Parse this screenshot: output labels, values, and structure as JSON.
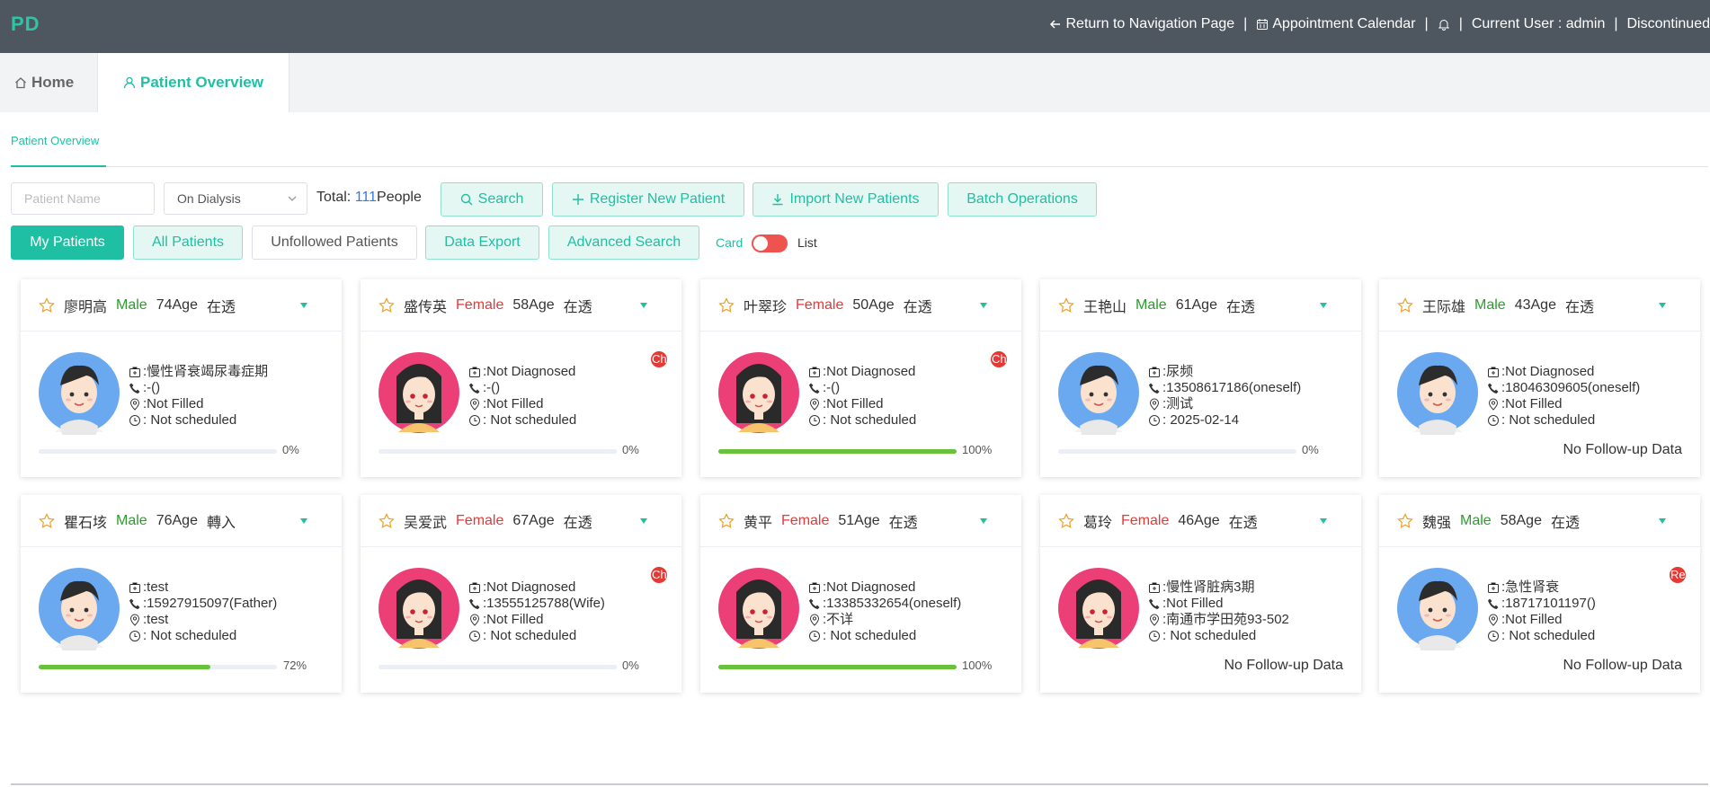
{
  "app": {
    "logo": "PD"
  },
  "topnav": {
    "return_label": "Return to Navigation Page",
    "calendar_label": "Appointment Calendar",
    "current_user": "Current User : admin",
    "discontinued": "Discontinued"
  },
  "tabs": {
    "home": "Home",
    "patient_overview": "Patient Overview"
  },
  "page": {
    "subtitle": "Patient Overview"
  },
  "filters": {
    "name_placeholder": "Patient Name",
    "status_value": "On Dialysis",
    "total_label": "Total:",
    "total_count": "111",
    "total_unit": "People"
  },
  "toolbar": {
    "search": "Search",
    "register": "Register New Patient",
    "import": "Import New Patients",
    "batch": "Batch Operations",
    "my_patients": "My Patients",
    "all_patients": "All Patients",
    "unfollowed": "Unfollowed Patients",
    "export": "Data Export",
    "advanced": "Advanced Search",
    "view_card": "Card",
    "view_list": "List"
  },
  "colors": {
    "accent": "#1fbfa4",
    "topbar": "#4e5660",
    "male": "#2a9d2a",
    "female": "#e53935",
    "progress": "#67c23a"
  },
  "patients": [
    {
      "name": "廖明高",
      "gender": "Male",
      "age": "74Age",
      "status": "在透",
      "diagnosis": ":慢性肾衰竭尿毒症期",
      "phone": ":-()",
      "address": ":Not Filled",
      "schedule": ": Not scheduled",
      "progress": 0,
      "progress_label": "0%",
      "followup": "",
      "badge": ""
    },
    {
      "name": "盛传英",
      "gender": "Female",
      "age": "58Age",
      "status": "在透",
      "diagnosis": ":Not Diagnosed",
      "phone": ":-()",
      "address": ":Not Filled",
      "schedule": ": Not scheduled",
      "progress": 0,
      "progress_label": "0%",
      "followup": "",
      "badge": "Ch"
    },
    {
      "name": "叶翠珍",
      "gender": "Female",
      "age": "50Age",
      "status": "在透",
      "diagnosis": ":Not Diagnosed",
      "phone": ":-()",
      "address": ":Not Filled",
      "schedule": ": Not scheduled",
      "progress": 100,
      "progress_label": "100%",
      "followup": "",
      "badge": "Ch"
    },
    {
      "name": "王艳山",
      "gender": "Male",
      "age": "61Age",
      "status": "在透",
      "diagnosis": ":尿频",
      "phone": ":13508617186(oneself)",
      "address": ":测试",
      "schedule": ": 2025-02-14",
      "progress": 0,
      "progress_label": "0%",
      "followup": "",
      "badge": ""
    },
    {
      "name": "王际雄",
      "gender": "Male",
      "age": "43Age",
      "status": "在透",
      "diagnosis": ":Not Diagnosed",
      "phone": ":18046309605(oneself)",
      "address": ":Not Filled",
      "schedule": ": Not scheduled",
      "progress": null,
      "progress_label": "",
      "followup": "No Follow-up Data",
      "badge": ""
    },
    {
      "name": "瞿石垓",
      "gender": "Male",
      "age": "76Age",
      "status": "轉入",
      "diagnosis": ":test",
      "phone": ":15927915097(Father)",
      "address": ":test",
      "schedule": ": Not scheduled",
      "progress": 72,
      "progress_label": "72%",
      "followup": "",
      "badge": ""
    },
    {
      "name": "吴爱武",
      "gender": "Female",
      "age": "67Age",
      "status": "在透",
      "diagnosis": ":Not Diagnosed",
      "phone": ":13555125788(Wife)",
      "address": ":Not Filled",
      "schedule": ": Not scheduled",
      "progress": 0,
      "progress_label": "0%",
      "followup": "",
      "badge": "Ch"
    },
    {
      "name": "黄平",
      "gender": "Female",
      "age": "51Age",
      "status": "在透",
      "diagnosis": ":Not Diagnosed",
      "phone": ":13385332654(oneself)",
      "address": ":不详",
      "schedule": ": Not scheduled",
      "progress": 100,
      "progress_label": "100%",
      "followup": "",
      "badge": ""
    },
    {
      "name": "葛玲",
      "gender": "Female",
      "age": "46Age",
      "status": "在透",
      "diagnosis": ":慢性肾脏病3期",
      "phone": ":Not Filled",
      "address": ":南通市学田苑93-502",
      "schedule": ": Not scheduled",
      "progress": null,
      "progress_label": "",
      "followup": "No Follow-up Data",
      "badge": ""
    },
    {
      "name": "魏强",
      "gender": "Male",
      "age": "58Age",
      "status": "在透",
      "diagnosis": ":急性肾衰",
      "phone": ":18717101197()",
      "address": ":Not Filled",
      "schedule": ": Not scheduled",
      "progress": null,
      "progress_label": "",
      "followup": "No Follow-up Data",
      "badge": "Re"
    }
  ]
}
